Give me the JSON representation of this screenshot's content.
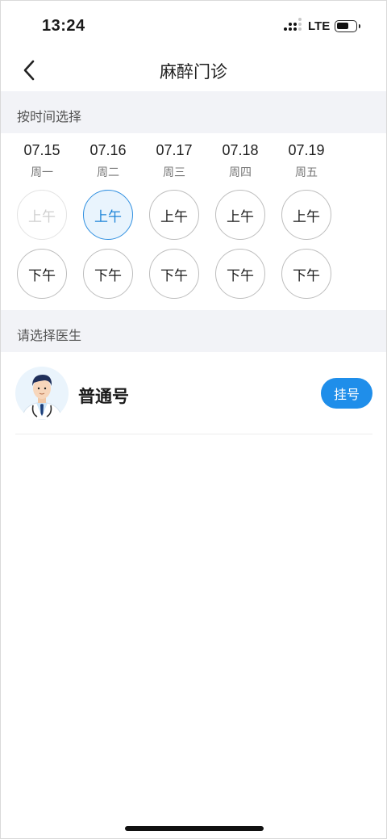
{
  "status_bar": {
    "time": "13:24",
    "network": "LTE"
  },
  "header": {
    "title": "麻醉门诊"
  },
  "time_section": {
    "label": "按时间选择"
  },
  "days": [
    {
      "date": "07.15",
      "weekday": "周一",
      "am": "上午",
      "pm": "下午",
      "am_state": "disabled",
      "pm_state": "normal"
    },
    {
      "date": "07.16",
      "weekday": "周二",
      "am": "上午",
      "pm": "下午",
      "am_state": "selected",
      "pm_state": "normal"
    },
    {
      "date": "07.17",
      "weekday": "周三",
      "am": "上午",
      "pm": "下午",
      "am_state": "normal",
      "pm_state": "normal"
    },
    {
      "date": "07.18",
      "weekday": "周四",
      "am": "上午",
      "pm": "下午",
      "am_state": "normal",
      "pm_state": "normal"
    },
    {
      "date": "07.19",
      "weekday": "周五",
      "am": "上午",
      "pm": "下午",
      "am_state": "normal",
      "pm_state": "normal"
    }
  ],
  "doctor_section": {
    "label": "请选择医生"
  },
  "doctor": {
    "name": "普通号",
    "button_label": "挂号",
    "icon": "doctor-avatar"
  },
  "colors": {
    "accent": "#1f8eea",
    "selected_bg": "#e9f4fd",
    "section_bg": "#f2f3f7"
  }
}
